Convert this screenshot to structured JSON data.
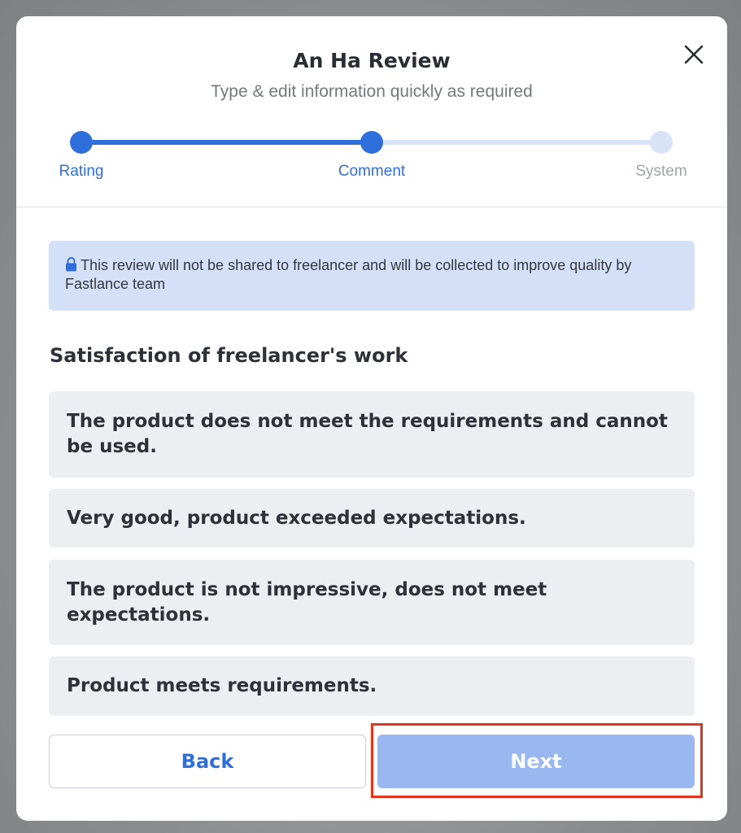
{
  "modal": {
    "title": "An Ha Review",
    "subtitle": "Type & edit information quickly as required"
  },
  "stepper": {
    "steps": [
      {
        "label": "Rating",
        "state": "completed"
      },
      {
        "label": "Comment",
        "state": "current"
      },
      {
        "label": "System",
        "state": "upcoming"
      }
    ]
  },
  "notice": {
    "icon": "lock-icon",
    "text": "This review will not be shared to freelancer and will be collected to improve quality by Fastlance team"
  },
  "section": {
    "title": "Satisfaction of freelancer's work"
  },
  "options": [
    {
      "label": "The product does not meet the requirements and cannot be used."
    },
    {
      "label": "Very good, product exceeded expectations."
    },
    {
      "label": "The product is not impressive, does not meet expectations."
    },
    {
      "label": "Product meets requirements."
    }
  ],
  "buttons": {
    "back_label": "Back",
    "next_label": "Next"
  },
  "colors": {
    "accent": "#2f6fdc",
    "accent_light": "#d8e3f8",
    "notice_bg": "#d3e0f8",
    "option_bg": "#eceef2",
    "next_disabled_bg": "#9ab7f0",
    "highlight": "#e0341e"
  }
}
